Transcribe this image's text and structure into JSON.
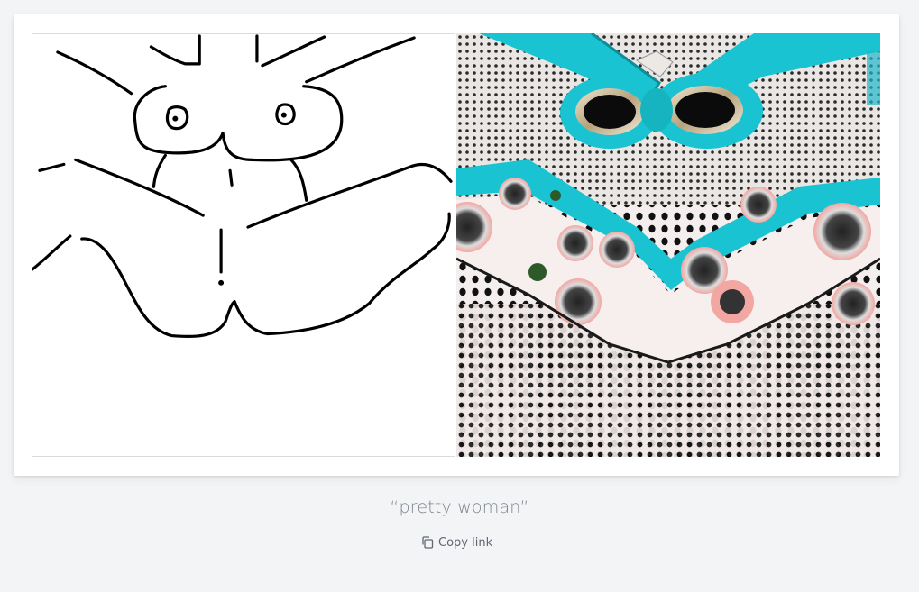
{
  "caption": "“pretty woman”",
  "copy_link": {
    "label": "Copy link",
    "icon": "copy-icon"
  },
  "images": {
    "sketch": "hand-drawn-sketch",
    "generated": "ai-generated-image"
  },
  "colors": {
    "background": "#f3f4f6",
    "card": "#ffffff",
    "caption_text": "#7d838c",
    "link_text": "#5f6670",
    "accent_teal": "#19c3d2",
    "accent_pink": "#f2a7a2"
  }
}
